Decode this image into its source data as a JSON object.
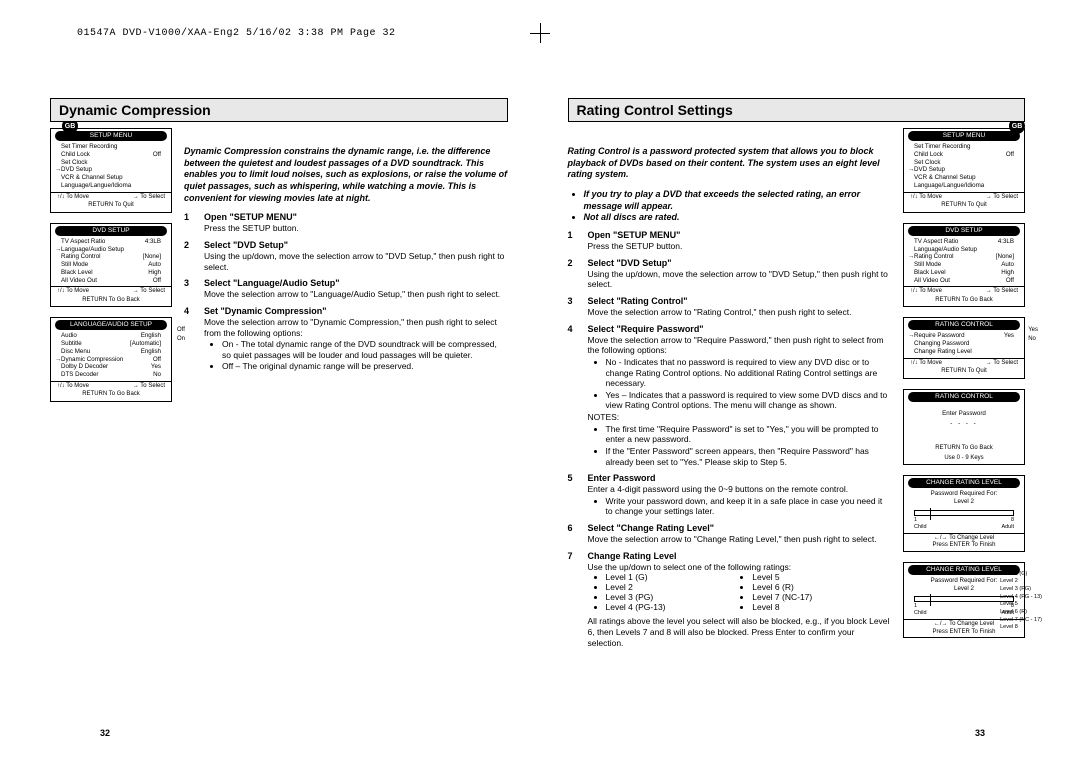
{
  "header": "01547A DVD-V1000/XAA-Eng2  5/16/02 3:38 PM  Page 32",
  "gb": "GB",
  "pageNumLeft": "32",
  "pageNumRight": "33",
  "left": {
    "title": "Dynamic Compression",
    "intro": "Dynamic Compression constrains the dynamic range, i.e. the difference between the quietest and loudest passages of a DVD soundtrack. This enables you to limit loud noises, such as explosions, or raise the volume of quiet passages, such as whispering, while watching a movie. This is convenient for viewing movies late at night.",
    "steps": [
      {
        "t": "Open \"SETUP MENU\"",
        "b": "Press the SETUP button."
      },
      {
        "t": "Select \"DVD Setup\"",
        "b": "Using the up/down, move the selection arrow to \"DVD Setup,\" then push right to select."
      },
      {
        "t": "Select \"Language/Audio Setup\"",
        "b": "Move the selection arrow to \"Language/Audio Setup,\" then push right to select."
      },
      {
        "t": "Set \"Dynamic Compression\"",
        "b": "Move the selection arrow to \"Dynamic Compression,\" then push right to select from the following options:",
        "sub": [
          "On - The total dynamic range of the DVD soundtrack will be compressed, so quiet passages will be louder and loud passages will be quieter.",
          "Off – The original dynamic range will be preserved."
        ]
      }
    ],
    "menu1": {
      "title": "SETUP MENU",
      "rows": [
        [
          "Set Timer Recording",
          ""
        ],
        [
          "Child Lock",
          "Off"
        ],
        [
          "Set Clock",
          ""
        ],
        [
          "DVD Setup",
          ""
        ],
        [
          "VCR & Channel Setup",
          ""
        ],
        [
          "Language/Langue/Idioma",
          ""
        ]
      ],
      "sel": 3,
      "f1": "↑/↓ To Move",
      "f2": "→ To Select",
      "f3": "RETURN To Quit"
    },
    "menu2": {
      "title": "DVD SETUP",
      "rows": [
        [
          "TV Aspect Ratio",
          "4:3LB"
        ],
        [
          "Language/Audio Setup",
          ""
        ],
        [
          "Rating Control",
          "[None]"
        ],
        [
          "Still Mode",
          "Auto"
        ],
        [
          "Black Level",
          "High"
        ],
        [
          "All Video Out",
          "Off"
        ]
      ],
      "sel": 1,
      "f1": "↑/↓ To Move",
      "f2": "→ To Select",
      "f3": "RETURN To Go Back"
    },
    "menu3": {
      "title": "LANGUAGE/AUDIO SETUP",
      "rows": [
        [
          "Audio",
          "English"
        ],
        [
          "Subtitle",
          "[Automatic]"
        ],
        [
          "Disc Menu",
          "English"
        ],
        [
          "Dynamic Compression",
          "Off"
        ],
        [
          "Dolby D Decoder",
          "Yes"
        ],
        [
          "DTS Decoder",
          "No"
        ]
      ],
      "sel": 3,
      "f1": "↑/↓ To Move",
      "f2": "→ To Select",
      "f3": "RETURN To Go Back",
      "side": [
        "Off",
        "On"
      ]
    }
  },
  "right": {
    "title": "Rating Control Settings",
    "intro": "Rating Control is a password protected system that allows you to block playback of DVDs based on their content. The system uses an eight level rating system.",
    "introBullets": [
      "If you try to play a DVD that exceeds the selected rating, an error message will appear.",
      "Not all discs are rated."
    ],
    "steps": [
      {
        "t": "Open \"SETUP MENU\"",
        "b": "Press the SETUP button."
      },
      {
        "t": "Select \"DVD Setup\"",
        "b": "Using the up/down, move the selection arrow to \"DVD Setup,\" then push right to select."
      },
      {
        "t": "Select \"Rating Control\"",
        "b": "Move the selection arrow to \"Rating Control,\" then push right to select."
      },
      {
        "t": "Select \"Require Password\"",
        "b": "Move the selection arrow to \"Require Password,\" then push right to select from the following options:",
        "sub": [
          "No - Indicates that no password is required to view any DVD disc or to change Rating Control options. No additional Rating Control settings are necessary.",
          "Yes – Indicates that a password is required to view some DVD discs and to view Rating Control options. The menu will change as shown."
        ],
        "notes": "NOTES:",
        "notesList": [
          "The first time \"Require Password\" is set to \"Yes,\" you will be prompted to enter a new password.",
          "If the \"Enter Password\" screen appears, then \"Require Password\" has already been set to \"Yes.\" Please skip to Step 5."
        ]
      },
      {
        "t": "Enter Password",
        "b": "Enter a 4-digit password using the 0~9 buttons on the remote control.",
        "sub": [
          "Write your password down, and keep it in a safe place in case you need it to change your settings later."
        ]
      },
      {
        "t": "Select \"Change Rating Level\"",
        "b": "Move the selection arrow to \"Change Rating Level,\" then push right to select."
      },
      {
        "t": "Change Rating Level",
        "b": "Use the up/down to select one of the following ratings:",
        "levels": [
          "Level 1 (G)",
          "Level 5",
          "Level 2",
          "Level 6 (R)",
          "Level 3 (PG)",
          "Level 7 (NC-17)",
          "Level 4 (PG-13)",
          "Level 8"
        ],
        "tail": "All ratings above the level you select will also be blocked, e.g., if you block Level 6, then Levels 7 and 8 will also be blocked. Press Enter to confirm your selection."
      }
    ],
    "menu1": {
      "title": "SETUP MENU",
      "rows": [
        [
          "Set Timer Recording",
          ""
        ],
        [
          "Child Lock",
          "Off"
        ],
        [
          "Set Clock",
          ""
        ],
        [
          "DVD Setup",
          ""
        ],
        [
          "VCR & Channel Setup",
          ""
        ],
        [
          "Language/Langue/Idioma",
          ""
        ]
      ],
      "sel": 3,
      "f1": "↑/↓ To Move",
      "f2": "→ To Select",
      "f3": "RETURN To Quit"
    },
    "menu2": {
      "title": "DVD SETUP",
      "rows": [
        [
          "TV Aspect Ratio",
          "4:3LB"
        ],
        [
          "Language/Audio Setup",
          ""
        ],
        [
          "Rating Control",
          "[None]"
        ],
        [
          "Still Mode",
          "Auto"
        ],
        [
          "Black Level",
          "High"
        ],
        [
          "All Video Out",
          "Off"
        ]
      ],
      "sel": 2,
      "f1": "↑/↓ To Move",
      "f2": "→ To Select",
      "f3": "RETURN To Go Back"
    },
    "menu3": {
      "title": "RATING CONTROL",
      "rows": [
        [
          "Require Password",
          "Yes"
        ],
        [
          "Changing Password",
          ""
        ],
        [
          "Change Rating Level",
          ""
        ]
      ],
      "sel": 0,
      "f1": "↑/↓ To Move",
      "f2": "→ To Select",
      "f3": "RETURN To Quit",
      "side": [
        "Yes",
        "No"
      ]
    },
    "menu4": {
      "title": "RATING CONTROL",
      "line1": "Enter Password",
      "dashes": "- - - -",
      "f2": "Use 0 - 9 Keys",
      "f3": "RETURN To Go Back"
    },
    "menu5": {
      "title": "CHANGE RATING LEVEL",
      "line": "Password Required For:",
      "lvl": "Level 2",
      "endL": "Child",
      "endR": "Adult",
      "markL": "1",
      "markR": "8",
      "f1": "←/→ To Change Level",
      "f2": "Press ENTER To Finish"
    },
    "menu6": {
      "title": "CHANGE RATING LEVEL",
      "line": "Password Required For:",
      "lvl": "Level 2",
      "endL": "Child",
      "endR": "Adult",
      "markL": "1",
      "markR": "8",
      "f1": "←/→ To Change Level",
      "f2": "Press ENTER To Finish",
      "side": [
        "Level 1 (G)",
        "Level 2",
        "Level 3 (PG)",
        "Level 4 (PG - 13)",
        "Level 5",
        "Level 6 (R)",
        "Level 7 (NC - 17)",
        "Level 8"
      ]
    }
  }
}
